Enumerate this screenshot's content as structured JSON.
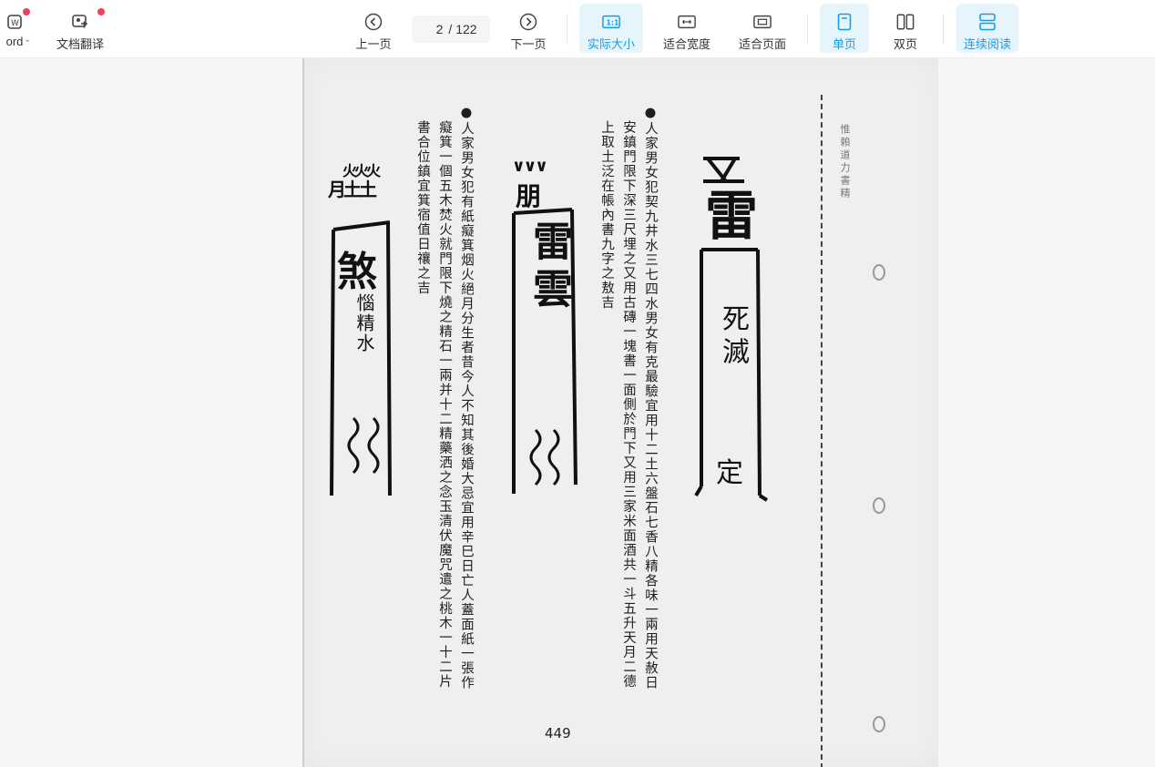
{
  "toolbar": {
    "left_partial_label": "ord",
    "translate_label": "文档翻译",
    "prev_label": "上一页",
    "next_label": "下一页",
    "current_page": "2",
    "total_pages": "/ 122",
    "actual_size_label": "实际大小",
    "fit_width_label": "适合宽度",
    "fit_page_label": "适合页面",
    "single_page_label": "单页",
    "double_page_label": "双页",
    "continuous_label": "连续阅读",
    "accent_color": "#1a9be8",
    "notification_dot_color": "#f2405a"
  },
  "document": {
    "col1": "●人家男女犯契九井水三七四水男女有克最驗宜用十二土六盤石七香八精各味一兩用天赦日",
    "col2": "安鎮門限下深三尺埋之又用古磚一塊書一面側於門下又用三家米面酒共一斗五升天月二德",
    "col3": "上取土泛在帳內書九字之敖吉",
    "col4": "●人家男女犯有紙癡箕烟火絕月分生者昔今人不知其後婚大忌宜用辛巳日亡人蓋面紙一張作",
    "col5": "癡箕一個五木焚火就門限下燒之精石一兩并十二精藥洒之念玉清伏魔咒遣之桃木一十二片",
    "col6": "書合位鎮宜箕宿值日禳之吉",
    "page_number": "449",
    "spine_text": "惟賴道力書精"
  },
  "talismans": {
    "t1_top": "文",
    "t1_main": "雷",
    "t1_mid": "死滅",
    "t1_bottom": "定",
    "t2_top": "∨∨∨",
    "t2_head": "朋",
    "t2_main": "雷雲",
    "t3_top": "火火火",
    "t3_head": "月土土",
    "t3_main": "煞",
    "t3_mid": "惱精水"
  }
}
